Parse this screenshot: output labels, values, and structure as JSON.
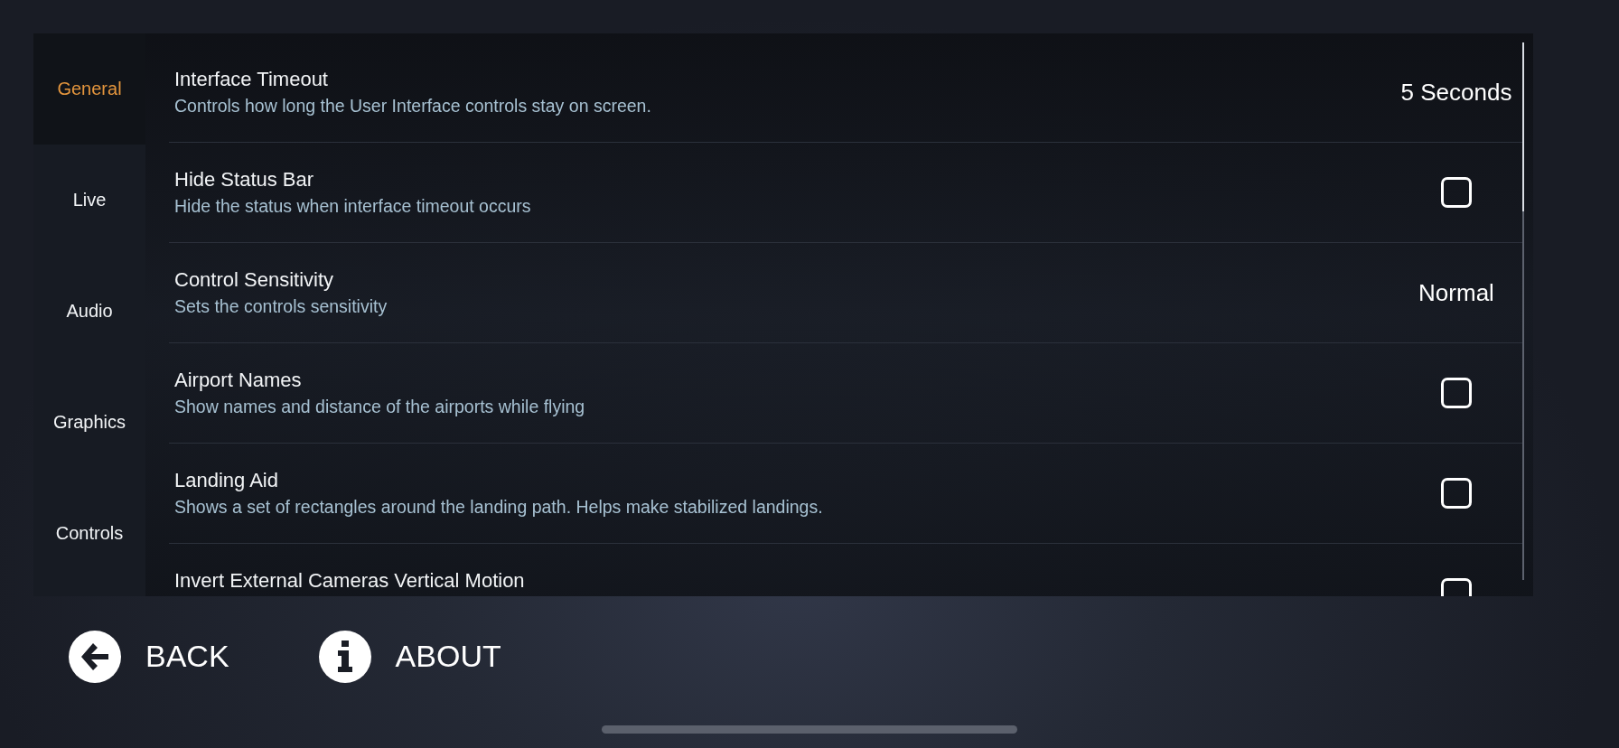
{
  "sidebar": {
    "items": [
      {
        "label": "General",
        "selected": true
      },
      {
        "label": "Live",
        "selected": false
      },
      {
        "label": "Audio",
        "selected": false
      },
      {
        "label": "Graphics",
        "selected": false
      },
      {
        "label": "Controls",
        "selected": false
      }
    ]
  },
  "settings": [
    {
      "title": "Interface Timeout",
      "description": "Controls how long the User Interface controls stay on screen.",
      "kind": "value",
      "value": "5 Seconds"
    },
    {
      "title": "Hide Status Bar",
      "description": "Hide the status when interface timeout occurs",
      "kind": "checkbox",
      "checked": false
    },
    {
      "title": "Control Sensitivity",
      "description": "Sets the controls sensitivity",
      "kind": "value",
      "value": "Normal"
    },
    {
      "title": "Airport Names",
      "description": "Show names and distance of the airports while flying",
      "kind": "checkbox",
      "checked": false
    },
    {
      "title": "Landing Aid",
      "description": "Shows a set of rectangles around the landing path. Helps make stabilized landings.",
      "kind": "checkbox",
      "checked": false
    },
    {
      "title": "Invert External Cameras Vertical Motion",
      "kind": "checkbox",
      "checked": false
    }
  ],
  "footer": {
    "buttons": [
      {
        "kind": "back",
        "label": "BACK"
      },
      {
        "kind": "about",
        "label": "ABOUT"
      }
    ]
  }
}
